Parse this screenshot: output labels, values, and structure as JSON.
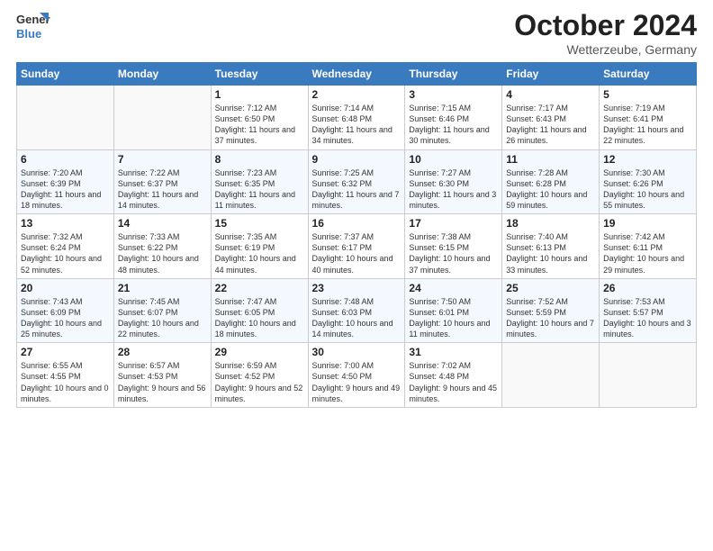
{
  "logo": {
    "general": "General",
    "blue": "Blue"
  },
  "title": {
    "month": "October 2024",
    "location": "Wetterzeube, Germany"
  },
  "days_of_week": [
    "Sunday",
    "Monday",
    "Tuesday",
    "Wednesday",
    "Thursday",
    "Friday",
    "Saturday"
  ],
  "weeks": [
    {
      "days": [
        {
          "num": "",
          "info": ""
        },
        {
          "num": "",
          "info": ""
        },
        {
          "num": "1",
          "info": "Sunrise: 7:12 AM\nSunset: 6:50 PM\nDaylight: 11 hours and 37 minutes."
        },
        {
          "num": "2",
          "info": "Sunrise: 7:14 AM\nSunset: 6:48 PM\nDaylight: 11 hours and 34 minutes."
        },
        {
          "num": "3",
          "info": "Sunrise: 7:15 AM\nSunset: 6:46 PM\nDaylight: 11 hours and 30 minutes."
        },
        {
          "num": "4",
          "info": "Sunrise: 7:17 AM\nSunset: 6:43 PM\nDaylight: 11 hours and 26 minutes."
        },
        {
          "num": "5",
          "info": "Sunrise: 7:19 AM\nSunset: 6:41 PM\nDaylight: 11 hours and 22 minutes."
        }
      ]
    },
    {
      "days": [
        {
          "num": "6",
          "info": "Sunrise: 7:20 AM\nSunset: 6:39 PM\nDaylight: 11 hours and 18 minutes."
        },
        {
          "num": "7",
          "info": "Sunrise: 7:22 AM\nSunset: 6:37 PM\nDaylight: 11 hours and 14 minutes."
        },
        {
          "num": "8",
          "info": "Sunrise: 7:23 AM\nSunset: 6:35 PM\nDaylight: 11 hours and 11 minutes."
        },
        {
          "num": "9",
          "info": "Sunrise: 7:25 AM\nSunset: 6:32 PM\nDaylight: 11 hours and 7 minutes."
        },
        {
          "num": "10",
          "info": "Sunrise: 7:27 AM\nSunset: 6:30 PM\nDaylight: 11 hours and 3 minutes."
        },
        {
          "num": "11",
          "info": "Sunrise: 7:28 AM\nSunset: 6:28 PM\nDaylight: 10 hours and 59 minutes."
        },
        {
          "num": "12",
          "info": "Sunrise: 7:30 AM\nSunset: 6:26 PM\nDaylight: 10 hours and 55 minutes."
        }
      ]
    },
    {
      "days": [
        {
          "num": "13",
          "info": "Sunrise: 7:32 AM\nSunset: 6:24 PM\nDaylight: 10 hours and 52 minutes."
        },
        {
          "num": "14",
          "info": "Sunrise: 7:33 AM\nSunset: 6:22 PM\nDaylight: 10 hours and 48 minutes."
        },
        {
          "num": "15",
          "info": "Sunrise: 7:35 AM\nSunset: 6:19 PM\nDaylight: 10 hours and 44 minutes."
        },
        {
          "num": "16",
          "info": "Sunrise: 7:37 AM\nSunset: 6:17 PM\nDaylight: 10 hours and 40 minutes."
        },
        {
          "num": "17",
          "info": "Sunrise: 7:38 AM\nSunset: 6:15 PM\nDaylight: 10 hours and 37 minutes."
        },
        {
          "num": "18",
          "info": "Sunrise: 7:40 AM\nSunset: 6:13 PM\nDaylight: 10 hours and 33 minutes."
        },
        {
          "num": "19",
          "info": "Sunrise: 7:42 AM\nSunset: 6:11 PM\nDaylight: 10 hours and 29 minutes."
        }
      ]
    },
    {
      "days": [
        {
          "num": "20",
          "info": "Sunrise: 7:43 AM\nSunset: 6:09 PM\nDaylight: 10 hours and 25 minutes."
        },
        {
          "num": "21",
          "info": "Sunrise: 7:45 AM\nSunset: 6:07 PM\nDaylight: 10 hours and 22 minutes."
        },
        {
          "num": "22",
          "info": "Sunrise: 7:47 AM\nSunset: 6:05 PM\nDaylight: 10 hours and 18 minutes."
        },
        {
          "num": "23",
          "info": "Sunrise: 7:48 AM\nSunset: 6:03 PM\nDaylight: 10 hours and 14 minutes."
        },
        {
          "num": "24",
          "info": "Sunrise: 7:50 AM\nSunset: 6:01 PM\nDaylight: 10 hours and 11 minutes."
        },
        {
          "num": "25",
          "info": "Sunrise: 7:52 AM\nSunset: 5:59 PM\nDaylight: 10 hours and 7 minutes."
        },
        {
          "num": "26",
          "info": "Sunrise: 7:53 AM\nSunset: 5:57 PM\nDaylight: 10 hours and 3 minutes."
        }
      ]
    },
    {
      "days": [
        {
          "num": "27",
          "info": "Sunrise: 6:55 AM\nSunset: 4:55 PM\nDaylight: 10 hours and 0 minutes."
        },
        {
          "num": "28",
          "info": "Sunrise: 6:57 AM\nSunset: 4:53 PM\nDaylight: 9 hours and 56 minutes."
        },
        {
          "num": "29",
          "info": "Sunrise: 6:59 AM\nSunset: 4:52 PM\nDaylight: 9 hours and 52 minutes."
        },
        {
          "num": "30",
          "info": "Sunrise: 7:00 AM\nSunset: 4:50 PM\nDaylight: 9 hours and 49 minutes."
        },
        {
          "num": "31",
          "info": "Sunrise: 7:02 AM\nSunset: 4:48 PM\nDaylight: 9 hours and 45 minutes."
        },
        {
          "num": "",
          "info": ""
        },
        {
          "num": "",
          "info": ""
        }
      ]
    }
  ]
}
